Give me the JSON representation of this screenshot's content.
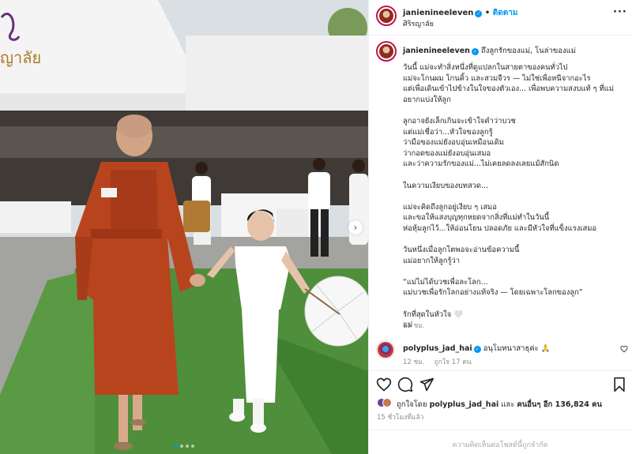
{
  "header": {
    "username": "janienineeleven",
    "follow_label": "ติดตาม",
    "location": "ศิริรญาลัย",
    "more_icon": "more-icon"
  },
  "caption": {
    "username": "janienineeleven",
    "headline": "ถึงลูกรักของแม่, โนล่าของแม่",
    "lines": [
      "วันนี้ แม่จะทำสิ่งหนึ่งที่ดูแปลกในสายตาของคนทั่วไป",
      "แม่จะโกนผม โกนคิ้ว และสวมจีวร — ไม่ใช่เพื่อหนีจากอะไร",
      "แต่เพื่อเดินเข้าไปข้างในใจของตัวเอง... เพื่อพบความสงบแท้ ๆ ที่แม่",
      "อยากแบ่งให้ลูก",
      "",
      "ลูกอาจยังเล็กเกินจะเข้าใจคำว่าบวช",
      "แต่แม่เชื่อว่า...หัวใจของลูกรู้",
      "ว่ามือของแม่ยังอบอุ่นเหมือนเดิม",
      "ว่ากอดของแม่ยังอบอุ่นเสมอ",
      "และว่าความรักของแม่...ไม่เคยลดลงเลยแม้สักนิด",
      "",
      "ในความเงียบของบทสวด...",
      "",
      "แม่จะคิดถึงลูกอยู่เงียบ ๆ เสมอ",
      "และขอให้แสงบุญทุกหยดจากสิ่งที่แม่ทำในวันนี้",
      "ห่อหุ้มลูกไว้...ให้อ่อนโยน ปลอดภัย และมีหัวใจที่แข็งแรงเสมอ",
      "",
      "วันหนึ่งเมื่อลูกโตพอจะอ่านข้อความนี้",
      "แม่อยากให้ลูกรู้ว่า",
      "",
      "“แม่ไม่ได้บวชเพื่อละโลก...",
      "แม่บวชเพื่อรักโลกอย่างแท้จริง — โดยเฉพาะโลกของลูก”",
      "",
      "รักที่สุดในหัวใจ 🤍",
      "แม่"
    ],
    "time": "15 ชม."
  },
  "comment": {
    "username": "polyplus_jad_hai",
    "text": "อนุโมทนาสาธุค่ะ 🙏",
    "time": "12 ชม.",
    "likes": "ถูกใจ 17 คน"
  },
  "likes": {
    "prefix": "ถูกใจโดย",
    "user": "polyplus_jad_hai",
    "joiner": "และ",
    "others": "คนอื่นๆ อีก 136,824 คน"
  },
  "post_time": "15 ชั่วโมงที่แล้ว",
  "comments_off": "ความคิดเห็นต่อโพสต์นี้ถูกจำกัด",
  "photo": {
    "carousel_total": 4,
    "carousel_active": 0,
    "next_icon": "chevron-right-icon"
  },
  "colors": {
    "accent": "#0095f6",
    "robe": "#b8441e",
    "grass": "#4f8f3b"
  }
}
